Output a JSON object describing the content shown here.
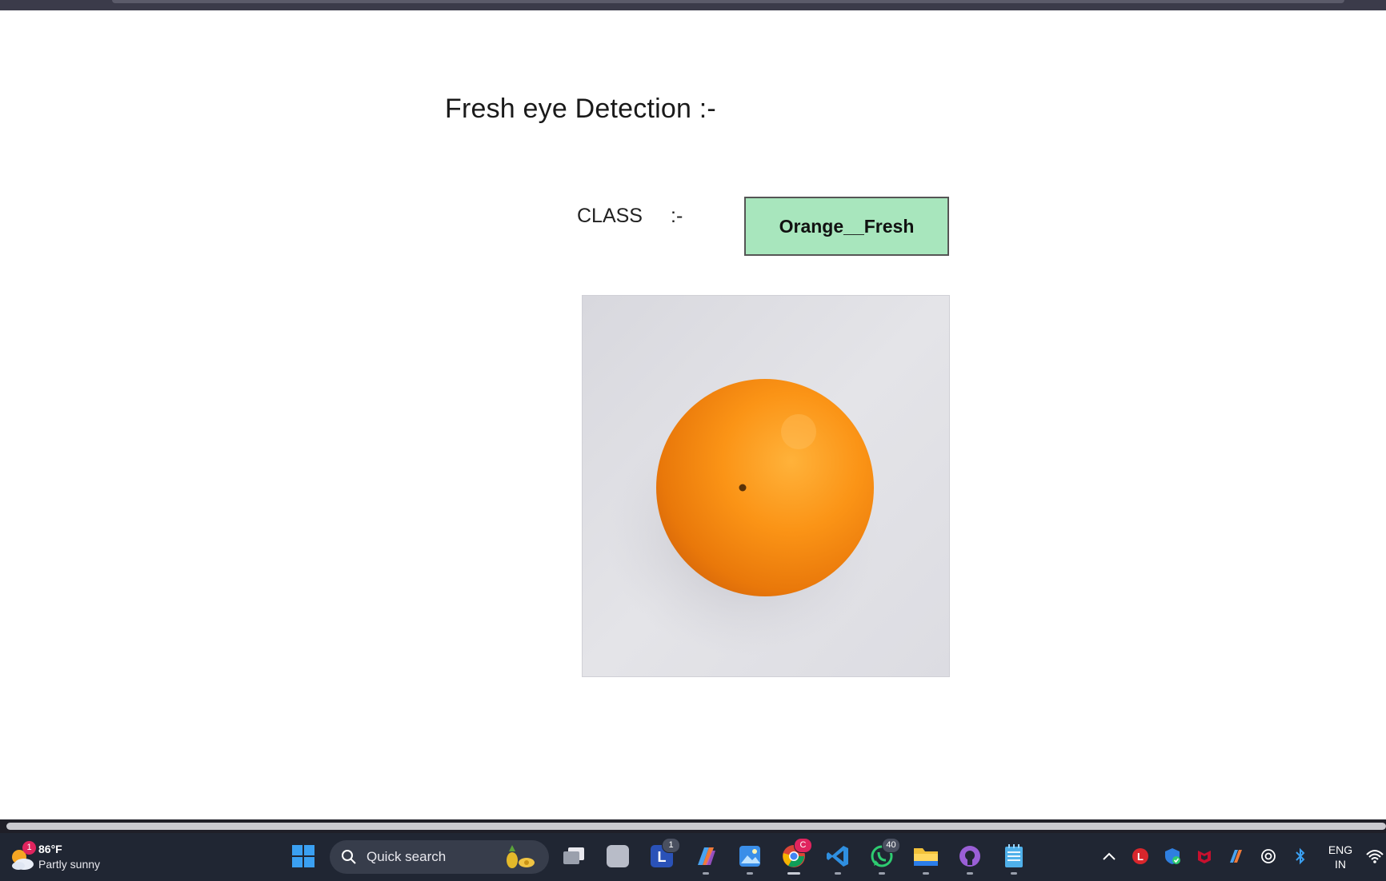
{
  "page": {
    "title": "Fresh eye Detection :-",
    "class_label": "CLASS",
    "class_separator": ":-",
    "class_value": "Orange__Fresh",
    "class_value_bg": "#a8e6bd"
  },
  "taskbar": {
    "weather": {
      "badge": "1",
      "temperature": "86°F",
      "condition": "Partly sunny"
    },
    "search_placeholder": "Quick search",
    "apps": [
      {
        "name": "start",
        "icon": "windows-logo-icon"
      },
      {
        "name": "task-view",
        "icon": "task-view-icon"
      },
      {
        "name": "blank-app",
        "icon": "app-icon"
      },
      {
        "name": "launcher",
        "icon": "l-app-icon",
        "badge": "1"
      },
      {
        "name": "copilot",
        "icon": "copilot-icon"
      },
      {
        "name": "photos",
        "icon": "photos-icon"
      },
      {
        "name": "chrome",
        "icon": "chrome-icon",
        "badge": "C"
      },
      {
        "name": "vscode",
        "icon": "vscode-icon"
      },
      {
        "name": "whatsapp",
        "icon": "whatsapp-icon",
        "badge": "40"
      },
      {
        "name": "file-explorer",
        "icon": "folder-icon"
      },
      {
        "name": "github",
        "icon": "github-icon"
      },
      {
        "name": "notepad",
        "icon": "notepad-icon"
      }
    ],
    "language_line1": "ENG",
    "language_line2": "IN"
  }
}
